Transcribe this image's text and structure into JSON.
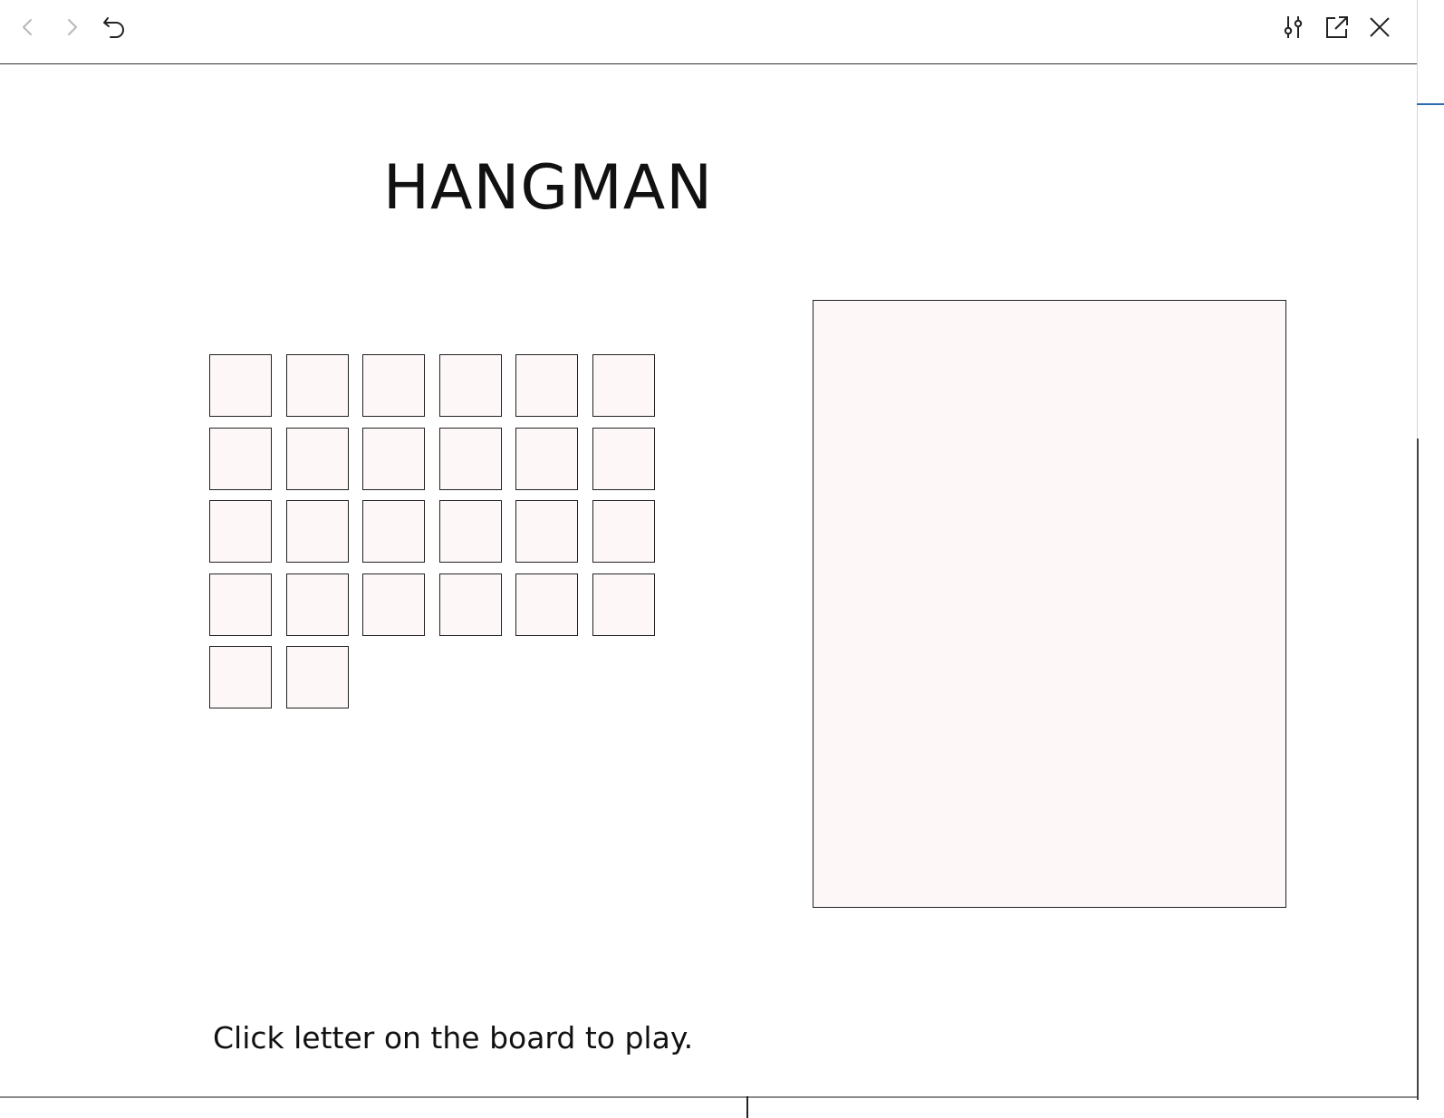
{
  "toolbar": {
    "back_icon": "chevron-left-icon",
    "forward_icon": "chevron-right-icon",
    "reload_icon": "undo-icon",
    "settings_icon": "sliders-icon",
    "open_external_icon": "open-external-icon",
    "close_icon": "close-icon"
  },
  "game": {
    "title": "HANGMAN",
    "tiles": [
      "",
      "",
      "",
      "",
      "",
      "",
      "",
      "",
      "",
      "",
      "",
      "",
      "",
      "",
      "",
      "",
      "",
      "",
      "",
      "",
      "",
      "",
      "",
      "",
      "",
      ""
    ],
    "status": "Click letter on the board to play."
  },
  "colors": {
    "tile_bg": "#fdf7f7",
    "border": "#222222",
    "accent_edge": "#2b6cb0"
  }
}
